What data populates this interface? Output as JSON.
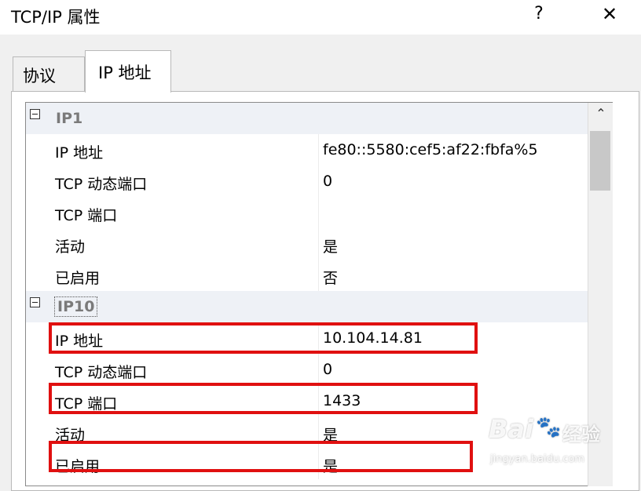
{
  "window": {
    "title": "TCP/IP 属性",
    "help_label": "?",
    "close_label": "✕"
  },
  "tabs": [
    {
      "label": "协议"
    },
    {
      "label": "IP 地址"
    }
  ],
  "groups": [
    {
      "name": "IP1",
      "rows": [
        {
          "name": "IP 地址",
          "value": "fe80::5580:cef5:af22:fbfa%5"
        },
        {
          "name": "TCP 动态端口",
          "value": "0"
        },
        {
          "name": "TCP 端口",
          "value": ""
        },
        {
          "name": "活动",
          "value": "是"
        },
        {
          "name": "已启用",
          "value": "否"
        }
      ]
    },
    {
      "name": "IP10",
      "rows": [
        {
          "name": "IP 地址",
          "value": "10.104.14.81"
        },
        {
          "name": "TCP 动态端口",
          "value": "0"
        },
        {
          "name": "TCP 端口",
          "value": "1433"
        },
        {
          "name": "活动",
          "value": "是"
        },
        {
          "name": "已启用",
          "value": "是"
        }
      ]
    }
  ],
  "scrollbar": {
    "up_arrow": "⌃"
  },
  "highlight_color": "#e01010",
  "watermark": {
    "brand": "Bai",
    "paw": "🐾",
    "cn": "经验",
    "url": "jingyan.baidu.com"
  }
}
